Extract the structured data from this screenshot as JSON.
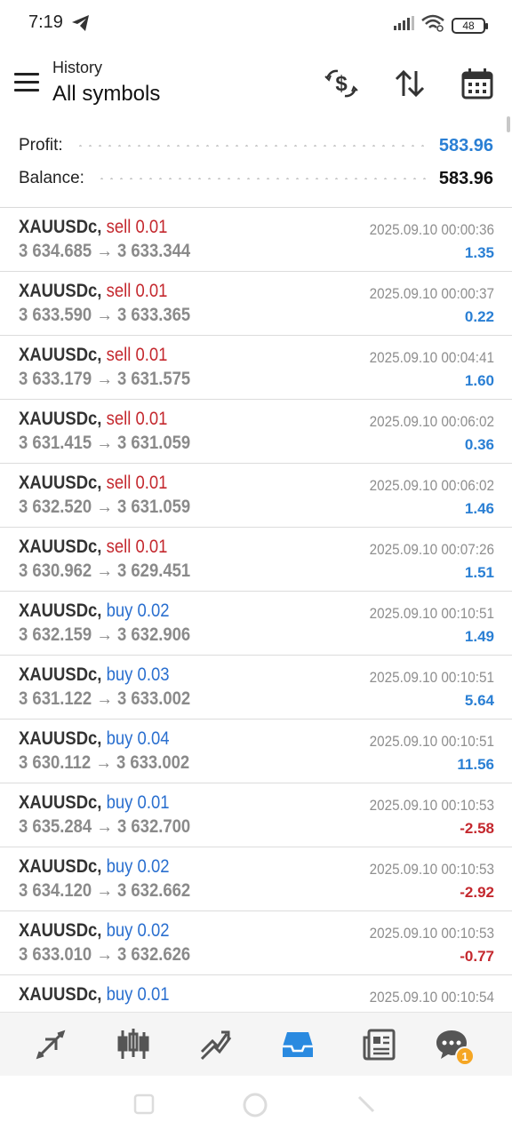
{
  "status_bar": {
    "time": "7:19",
    "battery": "48"
  },
  "header": {
    "subtitle": "History",
    "title": "All symbols",
    "icons": [
      "menu-icon",
      "dollar-exchange-icon",
      "sort-icon",
      "calendar-icon"
    ]
  },
  "summary": {
    "profit_label": "Profit:",
    "profit_value": "583.96",
    "balance_label": "Balance:",
    "balance_value": "583.96"
  },
  "trades": [
    {
      "symbol": "XAUUSDc,",
      "side": "sell",
      "volume": "0.01",
      "open": "3 634.685",
      "close": "3 633.344",
      "time": "2025.09.10 00:00:36",
      "pl": "1.35",
      "pl_positive": true
    },
    {
      "symbol": "XAUUSDc,",
      "side": "sell",
      "volume": "0.01",
      "open": "3 633.590",
      "close": "3 633.365",
      "time": "2025.09.10 00:00:37",
      "pl": "0.22",
      "pl_positive": true
    },
    {
      "symbol": "XAUUSDc,",
      "side": "sell",
      "volume": "0.01",
      "open": "3 633.179",
      "close": "3 631.575",
      "time": "2025.09.10 00:04:41",
      "pl": "1.60",
      "pl_positive": true
    },
    {
      "symbol": "XAUUSDc,",
      "side": "sell",
      "volume": "0.01",
      "open": "3 631.415",
      "close": "3 631.059",
      "time": "2025.09.10 00:06:02",
      "pl": "0.36",
      "pl_positive": true
    },
    {
      "symbol": "XAUUSDc,",
      "side": "sell",
      "volume": "0.01",
      "open": "3 632.520",
      "close": "3 631.059",
      "time": "2025.09.10 00:06:02",
      "pl": "1.46",
      "pl_positive": true
    },
    {
      "symbol": "XAUUSDc,",
      "side": "sell",
      "volume": "0.01",
      "open": "3 630.962",
      "close": "3 629.451",
      "time": "2025.09.10 00:07:26",
      "pl": "1.51",
      "pl_positive": true
    },
    {
      "symbol": "XAUUSDc,",
      "side": "buy",
      "volume": "0.02",
      "open": "3 632.159",
      "close": "3 632.906",
      "time": "2025.09.10 00:10:51",
      "pl": "1.49",
      "pl_positive": true
    },
    {
      "symbol": "XAUUSDc,",
      "side": "buy",
      "volume": "0.03",
      "open": "3 631.122",
      "close": "3 633.002",
      "time": "2025.09.10 00:10:51",
      "pl": "5.64",
      "pl_positive": true
    },
    {
      "symbol": "XAUUSDc,",
      "side": "buy",
      "volume": "0.04",
      "open": "3 630.112",
      "close": "3 633.002",
      "time": "2025.09.10 00:10:51",
      "pl": "11.56",
      "pl_positive": true
    },
    {
      "symbol": "XAUUSDc,",
      "side": "buy",
      "volume": "0.01",
      "open": "3 635.284",
      "close": "3 632.700",
      "time": "2025.09.10 00:10:53",
      "pl": "-2.58",
      "pl_positive": false
    },
    {
      "symbol": "XAUUSDc,",
      "side": "buy",
      "volume": "0.02",
      "open": "3 634.120",
      "close": "3 632.662",
      "time": "2025.09.10 00:10:53",
      "pl": "-2.92",
      "pl_positive": false
    },
    {
      "symbol": "XAUUSDc,",
      "side": "buy",
      "volume": "0.02",
      "open": "3 633.010",
      "close": "3 632.626",
      "time": "2025.09.10 00:10:53",
      "pl": "-0.77",
      "pl_positive": false
    },
    {
      "symbol": "XAUUSDc,",
      "side": "buy",
      "volume": "0.01",
      "open": "",
      "close": "",
      "time": "2025.09.10 00:10:54",
      "pl": "",
      "pl_positive": true
    }
  ],
  "arrow": "→",
  "bottom_nav": {
    "items": [
      "quotes-icon",
      "chart-icon",
      "trade-icon",
      "history-icon",
      "news-icon",
      "messages-icon"
    ],
    "active": "history-icon",
    "messages_badge": "1"
  },
  "colors": {
    "sell": "#c4282e",
    "buy": "#2a6fcf",
    "profit_positive": "#2a7fd4",
    "profit_negative": "#c4282e",
    "active_nav": "#2a8ae0",
    "badge": "#f5a623"
  }
}
